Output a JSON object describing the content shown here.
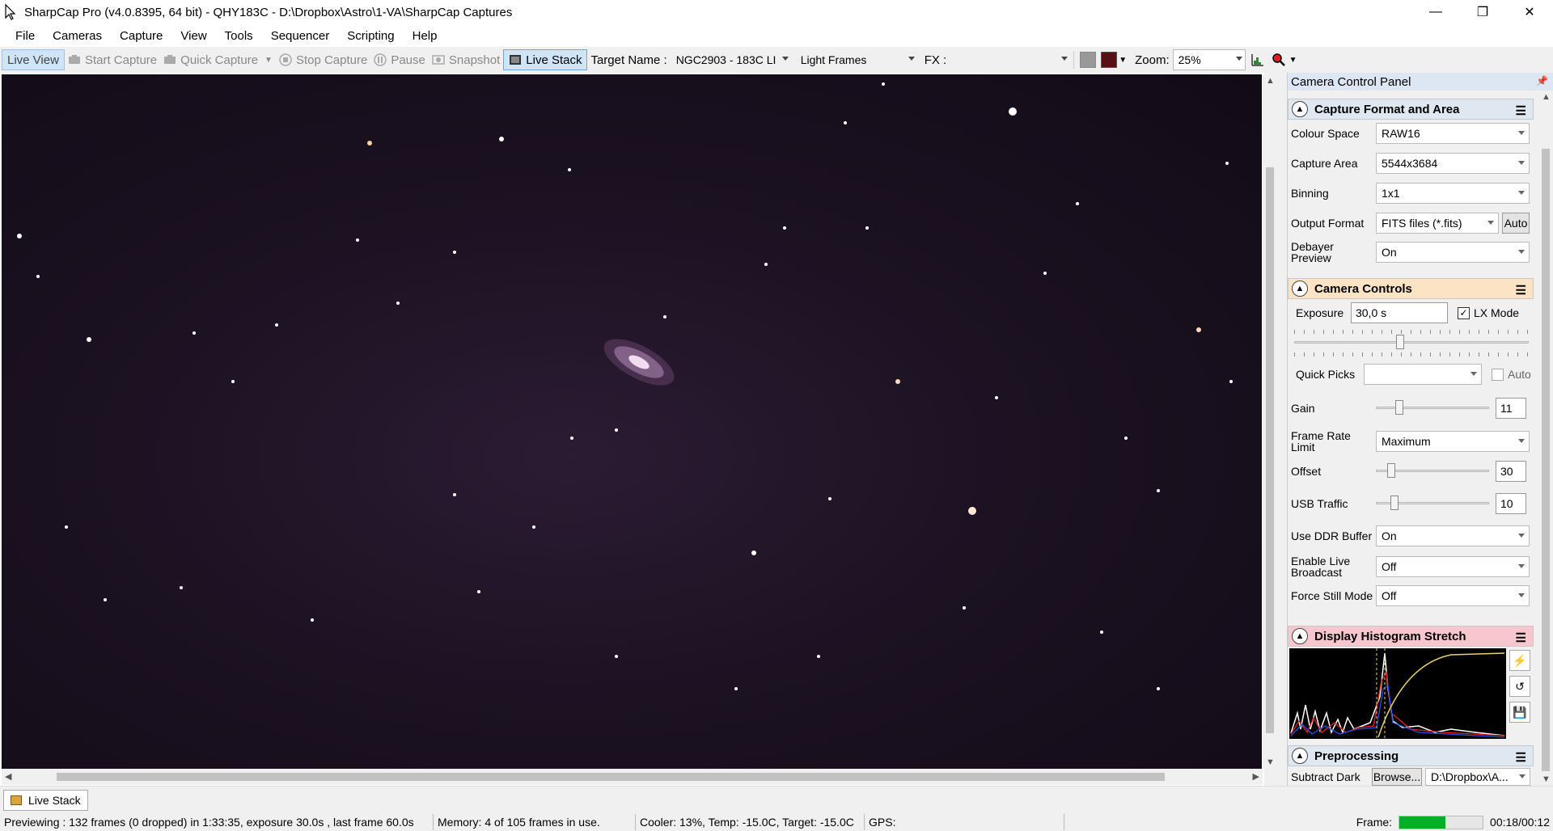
{
  "window": {
    "title": "SharpCap Pro (v4.0.8395, 64 bit) - QHY183C - D:\\Dropbox\\Astro\\1-VA\\SharpCap Captures",
    "minimize": "—",
    "maximize": "❐",
    "close": "✕"
  },
  "menu": [
    "File",
    "Cameras",
    "Capture",
    "View",
    "Tools",
    "Sequencer",
    "Scripting",
    "Help"
  ],
  "toolbar": {
    "live_view": "Live View",
    "start_capture": "Start Capture",
    "quick_capture": "Quick Capture",
    "stop_capture": "Stop Capture",
    "pause": "Pause",
    "snapshot": "Snapshot",
    "live_stack": "Live Stack",
    "target_label": "Target Name :",
    "target_value": "NGC2903 - 183C LI",
    "frame_type": "Light Frames",
    "fx_label": "FX :",
    "fx_value": "",
    "zoom_label": "Zoom:",
    "zoom_value": "25%"
  },
  "panel": {
    "title": "Camera Control Panel",
    "capture_format": {
      "header": "Capture Format and Area",
      "colour_space_label": "Colour Space",
      "colour_space": "RAW16",
      "capture_area_label": "Capture Area",
      "capture_area": "5544x3684",
      "binning_label": "Binning",
      "binning": "1x1",
      "output_format_label": "Output Format",
      "output_format": "FITS files (*.fits)",
      "auto_button": "Auto",
      "debayer_label": "Debayer Preview",
      "debayer": "On"
    },
    "camera_controls": {
      "header": "Camera Controls",
      "exposure_label": "Exposure",
      "exposure": "30,0 s",
      "lx_mode": "LX Mode",
      "quick_picks_label": "Quick Picks",
      "quick_picks": "",
      "auto_label": "Auto",
      "gain_label": "Gain",
      "gain": "11",
      "frame_rate_label": "Frame Rate Limit",
      "frame_rate": "Maximum",
      "offset_label": "Offset",
      "offset": "30",
      "usb_label": "USB Traffic",
      "usb": "10",
      "ddr_label": "Use DDR Buffer",
      "ddr": "On",
      "broadcast_label": "Enable Live Broadcast",
      "broadcast": "Off",
      "still_label": "Force Still Mode",
      "still": "Off"
    },
    "histogram": {
      "header": "Display Histogram Stretch"
    },
    "preprocessing": {
      "header": "Preprocessing",
      "subtract_dark_label": "Subtract Dark",
      "browse": "Browse...",
      "dark_path": "D:\\Dropbox\\A..."
    }
  },
  "bottom_tab": "Live Stack",
  "status": {
    "preview": "Previewing : 132 frames (0 dropped) in 1:33:35, exposure 30.0s , last frame 60.0s",
    "memory": "Memory: 4 of 105 frames in use.",
    "cooler": "Cooler: 13%, Temp: -15.0C, Target: -15.0C",
    "gps": "GPS:",
    "frame_label": "Frame:",
    "frame_progress": 0.55,
    "frame_time": "00:18/00:12"
  },
  "colors": {
    "accent": "#06b025",
    "histogram_header": "#f8c6cf",
    "camera_controls_header": "#fbe3c4"
  }
}
